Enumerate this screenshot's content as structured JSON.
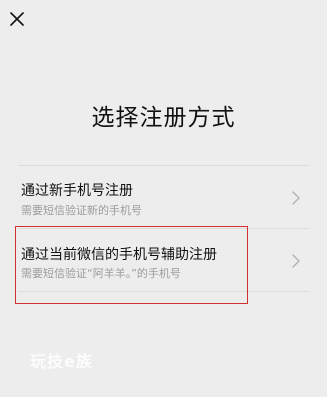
{
  "header": {
    "close_icon": "close-icon"
  },
  "page": {
    "title": "选择注册方式"
  },
  "options": [
    {
      "title": "通过新手机号注册",
      "subtitle": "需要短信验证新的手机号",
      "icon": "chevron-right-icon"
    },
    {
      "title": "通过当前微信的手机号辅助注册",
      "subtitle": "需要短信验证“阿羊羊。”的手机号",
      "icon": "chevron-right-icon"
    }
  ],
  "annotation": {
    "highlight_color": "#d32f2f"
  },
  "watermark": {
    "text": "玩技e族"
  },
  "colors": {
    "background": "#ededed",
    "divider": "#dcdcdc",
    "subtitle": "#9c9c9c",
    "chevron": "#b2b2b2"
  }
}
